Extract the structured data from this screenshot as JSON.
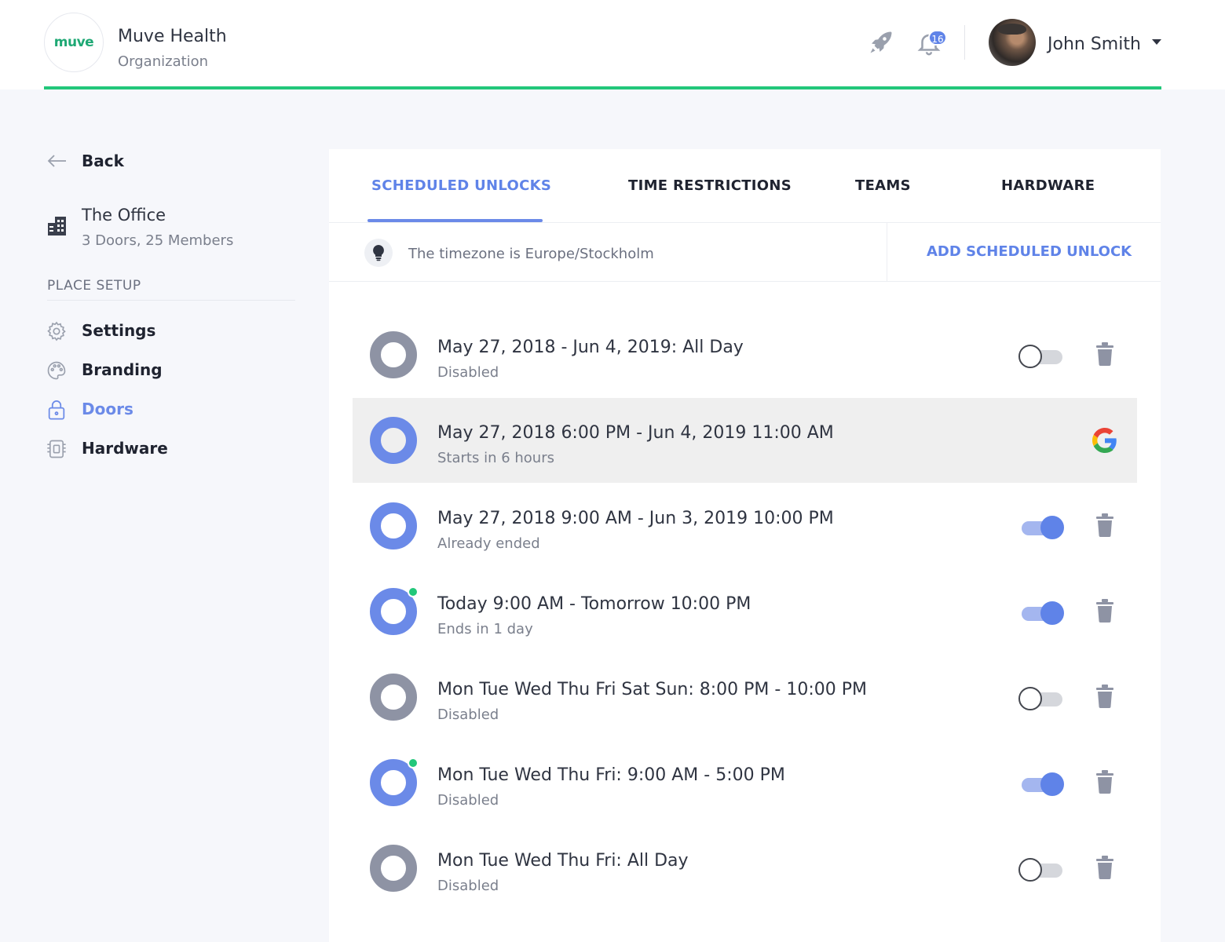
{
  "header": {
    "logo_text": "muve",
    "org_name": "Muve Health",
    "org_subtitle": "Organization",
    "notification_count": "16",
    "user_name": "John Smith"
  },
  "sidebar": {
    "back_label": "Back",
    "place_name": "The Office",
    "place_meta": "3 Doors, 25 Members",
    "section_title": "PLACE SETUP",
    "items": [
      {
        "label": "Settings",
        "icon": "gear-icon",
        "active": false
      },
      {
        "label": "Branding",
        "icon": "palette-icon",
        "active": false
      },
      {
        "label": "Doors",
        "icon": "lock-icon",
        "active": true
      },
      {
        "label": "Hardware",
        "icon": "chip-icon",
        "active": false
      }
    ]
  },
  "tabs": [
    {
      "label": "SCHEDULED UNLOCKS",
      "active": true
    },
    {
      "label": "TIME RESTRICTIONS",
      "active": false
    },
    {
      "label": "TEAMS",
      "active": false
    },
    {
      "label": "HARDWARE",
      "active": false
    }
  ],
  "timezone_text": "The timezone is Europe/Stockholm",
  "add_button_label": "ADD SCHEDULED UNLOCK",
  "unlocks": [
    {
      "title": "May 27, 2018 - Jun 4, 2019: All Day",
      "status": "Disabled",
      "enabled": false,
      "active_dot": false,
      "source": "manual"
    },
    {
      "title": "May 27, 2018 6:00 PM - Jun 4, 2019 11:00 AM",
      "status": "Starts in 6 hours",
      "enabled": true,
      "active_dot": false,
      "source": "google"
    },
    {
      "title": "May 27, 2018 9:00 AM - Jun 3, 2019 10:00 PM",
      "status": "Already ended",
      "enabled": true,
      "active_dot": false,
      "source": "manual"
    },
    {
      "title": "Today 9:00 AM - Tomorrow 10:00 PM",
      "status": "Ends in 1 day",
      "enabled": true,
      "active_dot": true,
      "source": "manual"
    },
    {
      "title": "Mon Tue Wed Thu Fri Sat Sun: 8:00 PM - 10:00 PM",
      "status": "Disabled",
      "enabled": false,
      "active_dot": false,
      "source": "manual"
    },
    {
      "title": "Mon Tue Wed Thu Fri: 9:00 AM - 5:00 PM",
      "status": "Disabled",
      "enabled": true,
      "active_dot": true,
      "source": "manual"
    },
    {
      "title": "Mon Tue Wed Thu Fri: All Day",
      "status": "Disabled",
      "enabled": false,
      "active_dot": false,
      "source": "manual"
    }
  ],
  "colors": {
    "accent": "#5f83e8",
    "success": "#22c77a",
    "muted_ring": "#8e93a4"
  }
}
